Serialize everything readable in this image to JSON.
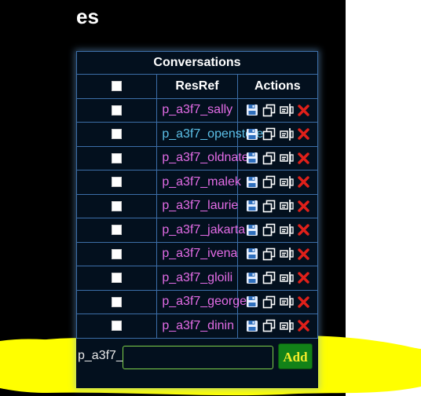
{
  "page": {
    "heading_fragment": "es"
  },
  "panel": {
    "title": "Conversations",
    "columns": {
      "resref": "ResRef",
      "actions": "Actions"
    },
    "rows": [
      {
        "resref": "p_a3f7_sally",
        "highlighted": false
      },
      {
        "resref": "p_a3f7_openstore",
        "highlighted": true
      },
      {
        "resref": "p_a3f7_oldnate",
        "highlighted": false
      },
      {
        "resref": "p_a3f7_malek",
        "highlighted": false
      },
      {
        "resref": "p_a3f7_laurie",
        "highlighted": false
      },
      {
        "resref": "p_a3f7_jakarta",
        "highlighted": false
      },
      {
        "resref": "p_a3f7_ivena",
        "highlighted": false
      },
      {
        "resref": "p_a3f7_gloili",
        "highlighted": false
      },
      {
        "resref": "p_a3f7_george",
        "highlighted": false
      },
      {
        "resref": "p_a3f7_dinin",
        "highlighted": false
      }
    ],
    "row_actions": [
      "save-icon",
      "copy-icon",
      "rename-icon",
      "delete-icon"
    ],
    "add": {
      "prefix": "p_a3f7_",
      "value": "",
      "button_label": "Add"
    }
  },
  "colors": {
    "panel_bg": "#03101e",
    "grid": "#3c6ea8",
    "link": "#e36ce6",
    "link_highlight": "#5cc0e8",
    "add_button": "#128218",
    "add_text": "#f3ec2a",
    "delete": "#e0201a",
    "highlighter": "#ffff00"
  }
}
